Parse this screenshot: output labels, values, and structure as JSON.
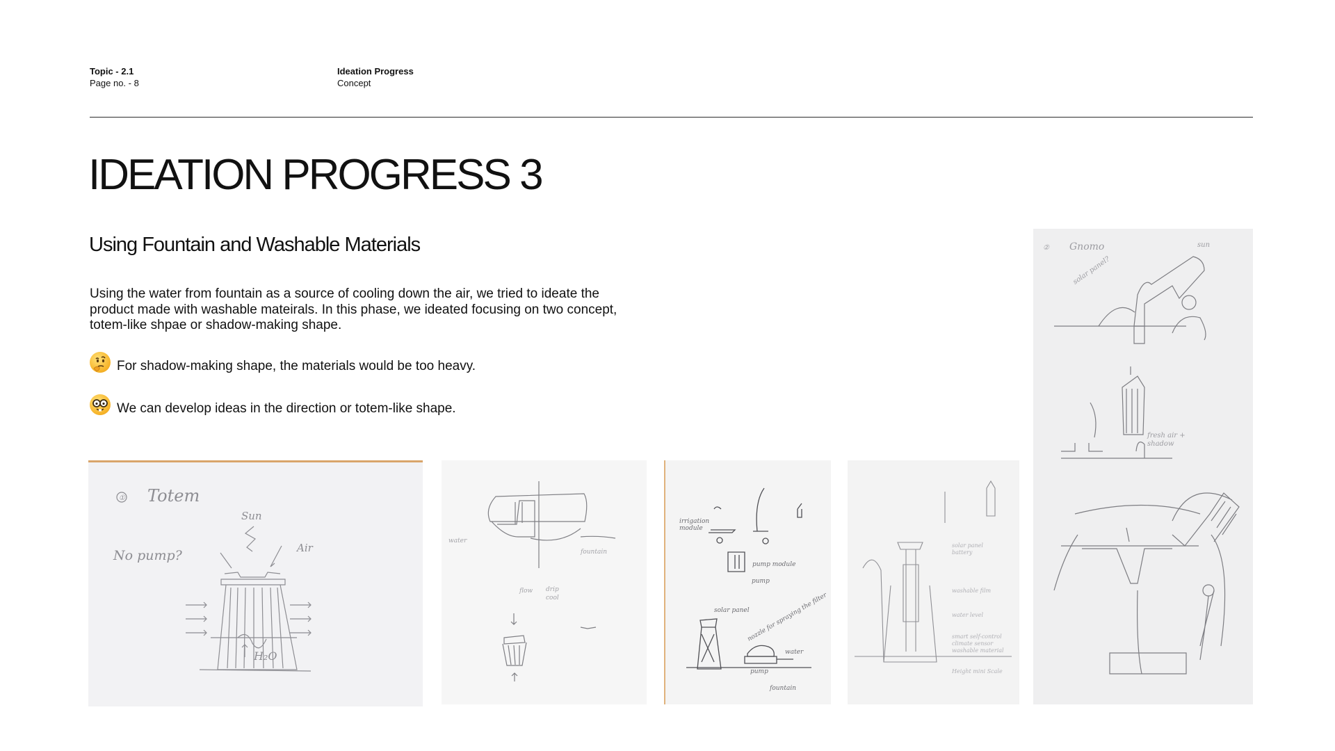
{
  "header": {
    "topic": "Topic - 2.1",
    "page_no": "Page no. - 8",
    "section_title": "Ideation Progress",
    "section_sub": "Concept"
  },
  "title": "IDEATION PROGRESS 3",
  "subtitle": "Using Fountain and Washable Materials",
  "body": "Using the water from fountain as a source of cooling down the air, we tried to ideate the product made with washable mateirals. In this phase, we ideated focusing on two concept, totem-like shpae or shadow-making shape.",
  "notes": [
    {
      "icon": "thinking-face-icon",
      "text": "For shadow-making shape, the materials would be too heavy."
    },
    {
      "icon": "nerd-face-icon",
      "text": "We can develop ideas in the direction or totem-like shape."
    }
  ],
  "sketches": {
    "totem": {
      "number": "①",
      "title": "Totem",
      "sun": "Sun",
      "air": "Air",
      "pump": "No pump?",
      "water": "H₂O"
    },
    "other": {
      "number": "②",
      "title": "Gnomo"
    }
  },
  "colors": {
    "text": "#111111",
    "divider": "#2a2a2a",
    "paper": "#f4f4f4",
    "pencil": "#8a8a8a"
  }
}
